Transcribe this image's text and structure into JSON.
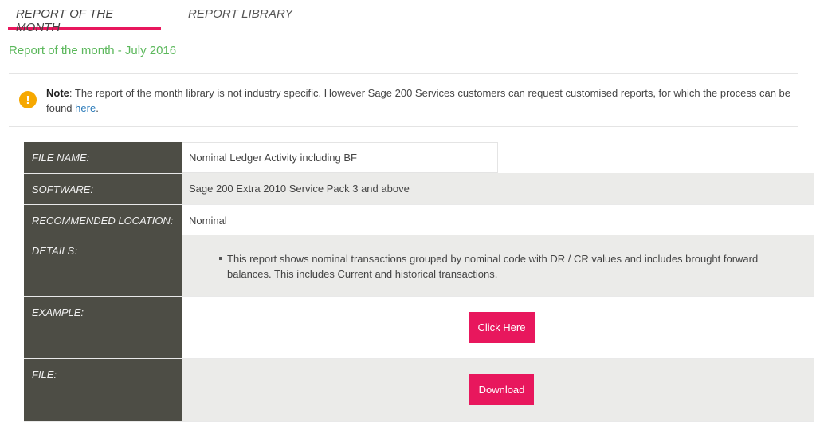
{
  "tabs": [
    {
      "label": "REPORT OF THE MONTH",
      "active": true
    },
    {
      "label": "REPORT LIBRARY",
      "active": false
    }
  ],
  "heading": "Report of the month - July 2016",
  "note": {
    "icon": "warning-icon",
    "bold": "Note",
    "text": ": The report of the month library is not industry specific. However Sage 200 Services customers can request customised reports, for which the process can be found ",
    "link": "here",
    "suffix": "."
  },
  "table": {
    "file_name_label": "FILE NAME:",
    "file_name_value": "Nominal Ledger Activity including BF",
    "software_label": "SOFTWARE:",
    "software_value": "Sage 200 Extra 2010 Service Pack 3 and above",
    "location_label": "RECOMMENDED LOCATION:",
    "location_value": "Nominal",
    "details_label": "DETAILS:",
    "details_items": [
      "This report shows nominal transactions grouped by nominal code with DR / CR values and includes brought forward balances. This includes Current and historical transactions."
    ],
    "example_label": "EXAMPLE:",
    "example_button": "Click Here",
    "file_label": "FILE:",
    "file_button": "Download"
  },
  "colors": {
    "accent": "#e8175d",
    "heading": "#5cb85c",
    "label_bg": "#4d4d45",
    "warning": "#f6a800",
    "link": "#2a7ab9"
  }
}
